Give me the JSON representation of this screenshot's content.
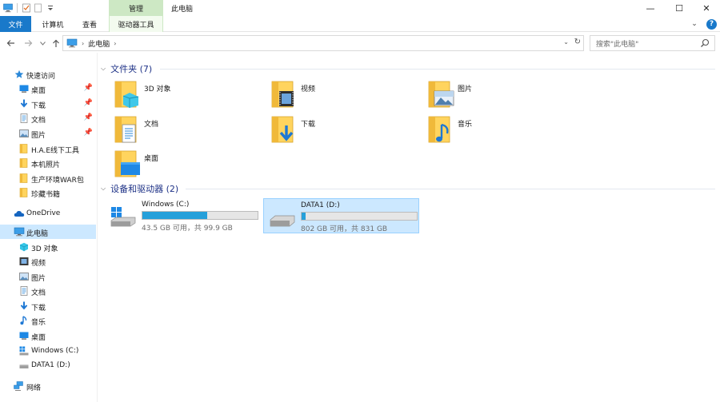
{
  "window": {
    "title": "此电脑",
    "context_tab_group": "管理",
    "minimize_glyph": "—",
    "maximize_glyph": "☐",
    "close_glyph": "✕"
  },
  "ribbon": {
    "tabs": [
      "文件",
      "计算机",
      "查看",
      "驱动器工具"
    ],
    "expand_glyph": "⌄",
    "help_glyph": "?"
  },
  "address": {
    "crumbs": [
      "此电脑"
    ],
    "search_placeholder": "搜索\"此电脑\""
  },
  "nav": {
    "quick_access": {
      "label": "快速访问",
      "items": [
        {
          "label": "桌面",
          "icon": "desktop-icon",
          "pinned": true
        },
        {
          "label": "下载",
          "icon": "download-icon",
          "pinned": true
        },
        {
          "label": "文档",
          "icon": "document-icon",
          "pinned": true
        },
        {
          "label": "图片",
          "icon": "pictures-icon",
          "pinned": true
        },
        {
          "label": "H.A.E线下工具",
          "icon": "folder-icon",
          "pinned": false
        },
        {
          "label": "本机照片",
          "icon": "folder-icon",
          "pinned": false
        },
        {
          "label": "生产环境WAR包",
          "icon": "folder-icon",
          "pinned": false
        },
        {
          "label": "珍藏书籍",
          "icon": "folder-icon",
          "pinned": false
        }
      ]
    },
    "onedrive": "OneDrive",
    "this_pc": {
      "label": "此电脑",
      "items": [
        {
          "label": "3D 对象",
          "icon": "3d-objects-icon"
        },
        {
          "label": "视频",
          "icon": "video-icon"
        },
        {
          "label": "图片",
          "icon": "pictures-icon"
        },
        {
          "label": "文档",
          "icon": "document-icon"
        },
        {
          "label": "下载",
          "icon": "download-icon"
        },
        {
          "label": "音乐",
          "icon": "music-icon"
        },
        {
          "label": "桌面",
          "icon": "desktop-icon"
        },
        {
          "label": "Windows (C:)",
          "icon": "system-drive-icon"
        },
        {
          "label": "DATA1 (D:)",
          "icon": "drive-icon"
        }
      ]
    },
    "network": "网络"
  },
  "content": {
    "folders_header": "文件夹 (7)",
    "folders": [
      {
        "label": "3D 对象",
        "icon": "3d-objects-folder-icon"
      },
      {
        "label": "视频",
        "icon": "video-folder-icon"
      },
      {
        "label": "图片",
        "icon": "pictures-folder-icon"
      },
      {
        "label": "文档",
        "icon": "documents-folder-icon"
      },
      {
        "label": "下载",
        "icon": "downloads-folder-icon"
      },
      {
        "label": "音乐",
        "icon": "music-folder-icon"
      },
      {
        "label": "桌面",
        "icon": "desktop-folder-icon"
      }
    ],
    "devices_header": "设备和驱动器 (2)",
    "drives": [
      {
        "name": "Windows (C:)",
        "free": "43.5 GB 可用，共 99.9 GB",
        "used_fraction": 0.565,
        "selected": false,
        "icon": "system-drive-icon"
      },
      {
        "name": "DATA1 (D:)",
        "free": "802 GB 可用，共 831 GB",
        "used_fraction": 0.035,
        "selected": true,
        "icon": "drive-icon"
      }
    ]
  },
  "colors": {
    "accent": "#1979ca",
    "header_text": "#1e3287",
    "selection": "#cce8ff",
    "context_tab": "#cde8c4",
    "usage_bar": "#26a0da"
  }
}
